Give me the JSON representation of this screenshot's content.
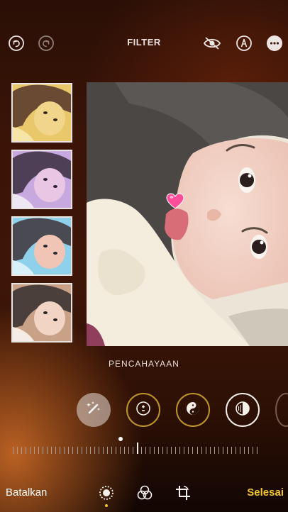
{
  "header": {
    "title": "FILTER",
    "undo_icon": "undo-icon",
    "redo_icon": "redo-icon",
    "hide_icon": "eye-slash-icon",
    "markup_icon": "markup-pen-icon",
    "more_icon": "more-ellipsis-icon"
  },
  "thumbnails": [
    {
      "tint": "#e8c86a"
    },
    {
      "tint": "#c7a9e0"
    },
    {
      "tint": "#8fd0ea"
    },
    {
      "tint": "#c9a187"
    }
  ],
  "main_photo": {
    "sticker_icon": "heart-icon"
  },
  "adjust": {
    "section_label": "PENCAHAYAAN",
    "tools": [
      {
        "name": "auto-enhance-icon",
        "active": true
      },
      {
        "name": "exposure-icon"
      },
      {
        "name": "brilliance-icon"
      },
      {
        "name": "highlights-icon"
      }
    ],
    "slider_value_fraction": 0.5,
    "colors": {
      "accent": "#f2c530",
      "ring": "#b9952a"
    }
  },
  "footer": {
    "cancel_label": "Batalkan",
    "done_label": "Selesai",
    "tabs": [
      "adjust-dial-icon",
      "filters-icon",
      "crop-rotate-icon"
    ]
  }
}
